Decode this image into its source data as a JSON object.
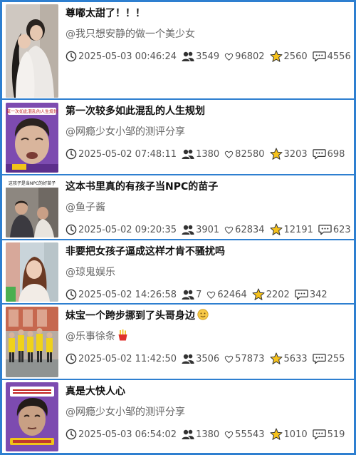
{
  "videos": [
    {
      "title": "尊嘟太甜了！！！",
      "author": "@我只想安静的做一个美少女",
      "time": "2025-05-03 00:46:24",
      "users": "3549",
      "likes": "96802",
      "stars": "2560",
      "comments": "4556"
    },
    {
      "title": "第一次较多如此混乱的人生规划",
      "author": "@网瘾少女小邹的测评分享",
      "time": "2025-05-02 07:48:11",
      "users": "1380",
      "likes": "82580",
      "stars": "3203",
      "comments": "698",
      "thumb_banner": "第一次如此混乱的人生规划"
    },
    {
      "title": "这本书里真的有孩子当NPC的苗子",
      "author": "@鱼子酱",
      "time": "2025-05-02 09:20:35",
      "users": "3901",
      "likes": "62834",
      "stars": "12191",
      "comments": "623",
      "thumb_banner": "这孩子是当NPC的好苗子"
    },
    {
      "title": "非要把女孩子逼成这样才肯不骚扰吗",
      "author": "@琼鬼娱乐",
      "time": "2025-05-02 14:26:58",
      "users": "7",
      "likes": "62464",
      "stars": "2202",
      "comments": "342"
    },
    {
      "title": "妹宝一个跨步挪到了头哥身边",
      "author": "@乐事徐条",
      "time": "2025-05-02 11:42:50",
      "users": "3506",
      "likes": "57873",
      "stars": "5633",
      "comments": "255"
    },
    {
      "title": "真是大快人心",
      "author": "@网瘾少女小邹的测评分享",
      "time": "2025-05-03 06:54:02",
      "users": "1380",
      "likes": "55543",
      "stars": "1010",
      "comments": "519"
    }
  ]
}
